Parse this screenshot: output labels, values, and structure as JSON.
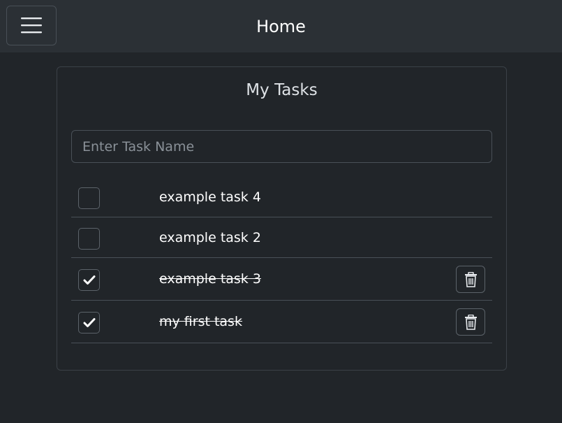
{
  "navbar": {
    "menu_icon": "hamburger-menu-icon",
    "title": "Home"
  },
  "card": {
    "title": "My Tasks",
    "input": {
      "value": "",
      "placeholder": "Enter Task Name"
    }
  },
  "tasks": [
    {
      "label": "example task 4",
      "checked": false,
      "deletable": false
    },
    {
      "label": "example task 2",
      "checked": false,
      "deletable": false
    },
    {
      "label": "example task 3",
      "checked": true,
      "deletable": true
    },
    {
      "label": "my first task",
      "checked": true,
      "deletable": true
    }
  ],
  "icons": {
    "check": "check-icon",
    "delete": "trash-icon"
  },
  "colors": {
    "background": "#212529",
    "navbar": "#2b3035",
    "border": "#495057",
    "text": "#ffffff"
  }
}
